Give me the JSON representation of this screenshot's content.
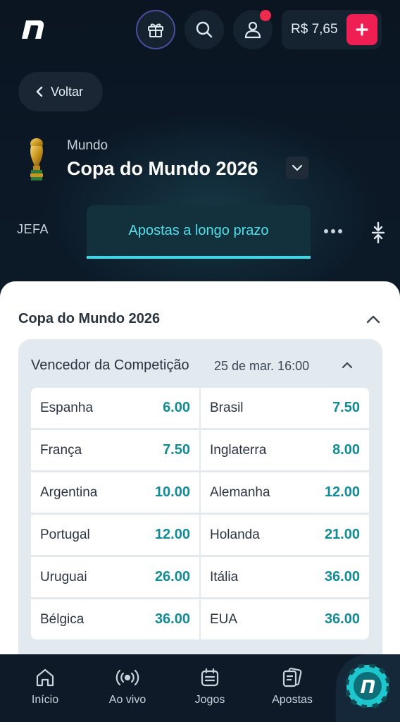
{
  "header": {
    "balance": "R$ 7,65",
    "deposit_symbol": "+",
    "icons": [
      "logo-n",
      "gift-icon",
      "search-icon",
      "user-icon",
      "plus-icon"
    ]
  },
  "nav": {
    "back_label": "Voltar"
  },
  "competition": {
    "region": "Mundo",
    "title": "Copa do Mundo 2026"
  },
  "tabs": {
    "partial_tab": "JEFA",
    "active_tab": "Apostas a longo prazo"
  },
  "section": {
    "title": "Copa do Mundo 2026"
  },
  "market": {
    "title": "Vencedor da Competição",
    "date": "25 de mar. 16:00",
    "selections": [
      {
        "name": "Espanha",
        "odd": "6.00"
      },
      {
        "name": "Brasil",
        "odd": "7.50"
      },
      {
        "name": "França",
        "odd": "7.50"
      },
      {
        "name": "Inglaterra",
        "odd": "8.00"
      },
      {
        "name": "Argentina",
        "odd": "10.00"
      },
      {
        "name": "Alemanha",
        "odd": "12.00"
      },
      {
        "name": "Portugal",
        "odd": "12.00"
      },
      {
        "name": "Holanda",
        "odd": "21.00"
      },
      {
        "name": "Uruguai",
        "odd": "26.00"
      },
      {
        "name": "Itália",
        "odd": "36.00"
      },
      {
        "name": "Bélgica",
        "odd": "36.00"
      },
      {
        "name": "EUA",
        "odd": "36.00"
      }
    ]
  },
  "bottom_nav": {
    "home": "Início",
    "live": "Ao vivo",
    "games": "Jogos",
    "bets": "Apostas"
  },
  "colors": {
    "background": "#0b1522",
    "accent": "#36d9e7",
    "odd_text": "#128b96",
    "deposit": "#ef1f53",
    "notification": "#ef2a4f"
  }
}
